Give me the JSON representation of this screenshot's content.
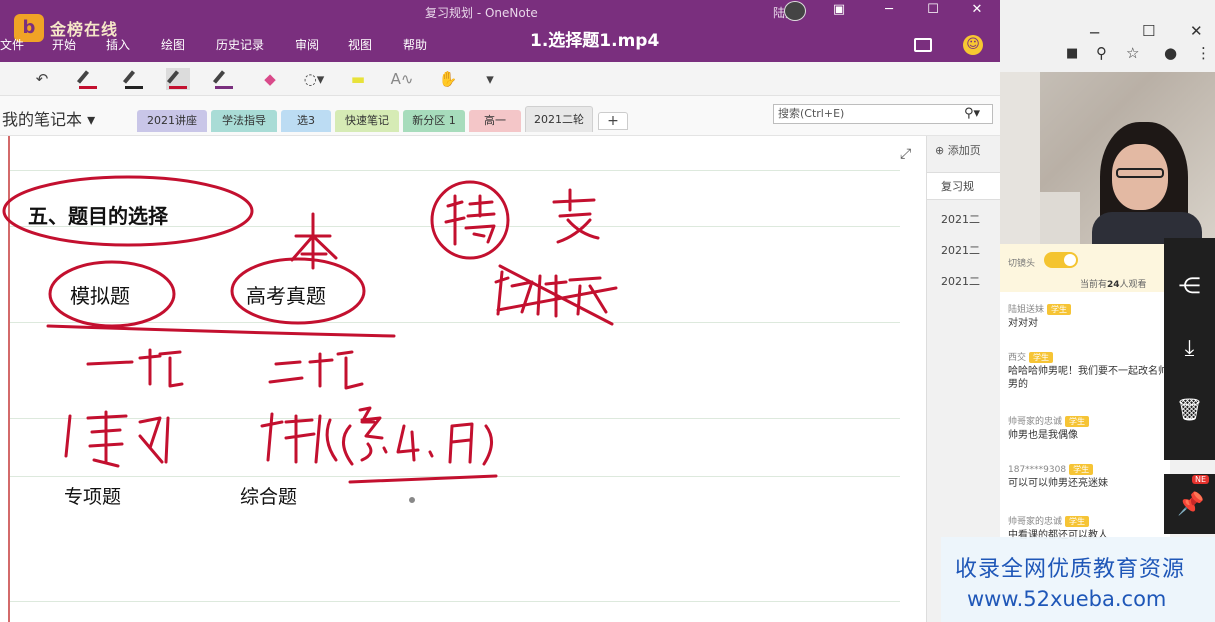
{
  "app": {
    "window_title": "复习规划 - OneNote",
    "video_title": "1.选择题1.mp4",
    "brand": "金榜在线",
    "user_name": "陆姐"
  },
  "menus": [
    "文件",
    "开始",
    "插入",
    "绘图",
    "历史记录",
    "审阅",
    "视图",
    "帮助"
  ],
  "notebook": {
    "name": "我的笔记本 ▾",
    "tabs": [
      {
        "label": "2021讲座",
        "color": "#c9c6e8"
      },
      {
        "label": "学法指导",
        "color": "#a9dcd6"
      },
      {
        "label": "选3",
        "color": "#bcdcf3"
      },
      {
        "label": "快速笔记",
        "color": "#d6ebb5"
      },
      {
        "label": "新分区 1",
        "color": "#a7dcbc"
      },
      {
        "label": "高一",
        "color": "#f4c6c8"
      },
      {
        "label": "2021二轮",
        "color": "#e8e8e8"
      }
    ],
    "add_tab": "+",
    "search_placeholder": "搜索(Ctrl+E)"
  },
  "page_list": {
    "add_label": "添加页",
    "items": [
      "复习规",
      "2021二",
      "2021二",
      "2021二"
    ]
  },
  "page_content": {
    "heading": "五、题目的选择",
    "item1": "模拟题",
    "item2": "高考真题",
    "sub1": "专项题",
    "sub2": "综合题"
  },
  "chat": {
    "camera_label": "切镜头",
    "online_prefix": "当前有",
    "online_count": "24",
    "online_suffix": "人观看",
    "messages": [
      {
        "who": "陆姐送妹",
        "badge": "学生",
        "text": "对对对"
      },
      {
        "who": "西交",
        "badge": "学生",
        "text": "哈哈哈帅男呢！我们要不一起改名帅男的"
      },
      {
        "who": "帅哥家的忠诚",
        "badge": "学生",
        "text": "帅男也是我偶像"
      },
      {
        "who": "187****9308",
        "badge": "学生",
        "text": "可以可以帅男还亮迷妹"
      },
      {
        "who": "帅哥家的忠诚",
        "badge": "学生",
        "text": "中看课的都还可以教人"
      }
    ]
  },
  "new_badge": "NE",
  "watermark": {
    "line1": "收录全网优质教育资源",
    "line2": "www.52xueba.com"
  },
  "colors": {
    "title_bar": "#7a2f7e",
    "ink_red": "#c3102f",
    "watermark_blue": "#1f57b8"
  }
}
